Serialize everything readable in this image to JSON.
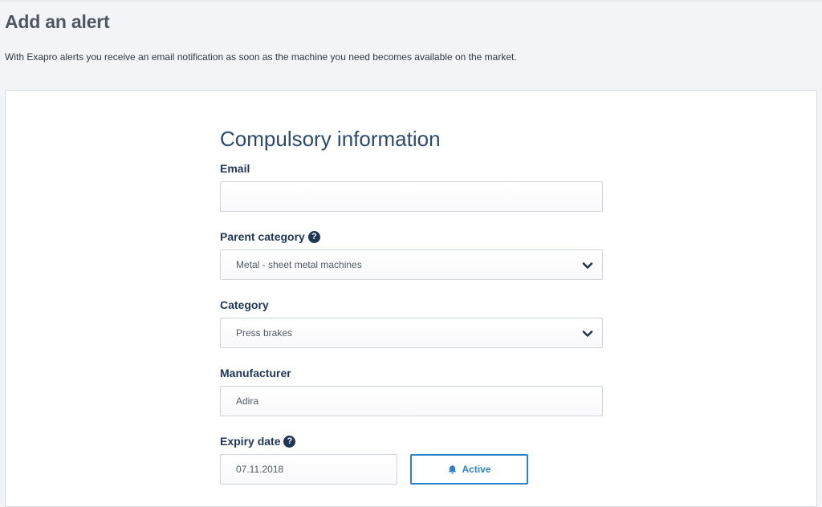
{
  "page": {
    "title": "Add an alert",
    "intro": "With Exapro alerts you receive an email notification as soon as the machine you need becomes available on the market."
  },
  "form": {
    "section_title": "Compulsory information",
    "email": {
      "label": "Email",
      "value": "",
      "placeholder": ""
    },
    "parent_category": {
      "label": "Parent category",
      "help_icon": "?",
      "value": "Metal - sheet metal machines"
    },
    "category": {
      "label": "Category",
      "value": "Press brakes"
    },
    "manufacturer": {
      "label": "Manufacturer",
      "value": "Adira"
    },
    "expiry_date": {
      "label": "Expiry date",
      "help_icon": "?",
      "value": "07.11.2018"
    },
    "status_button": {
      "label": "Active",
      "icon": "bell-icon"
    }
  },
  "colors": {
    "label_navy": "#1f3656",
    "title_blue": "#2c4a6e",
    "accent_blue": "#2c82c9",
    "page_bg": "#f3f4f8"
  }
}
